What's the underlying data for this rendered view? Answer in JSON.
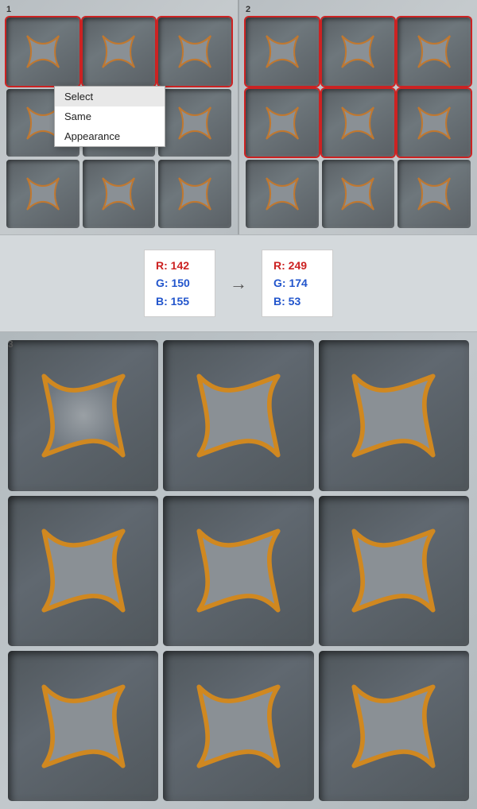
{
  "panels": [
    {
      "id": 1,
      "label": "1"
    },
    {
      "id": 2,
      "label": "2"
    },
    {
      "id": 3,
      "label": "3"
    }
  ],
  "contextMenu": {
    "items": [
      {
        "label": "Select",
        "selected": true
      },
      {
        "label": "Same",
        "hovered": false
      },
      {
        "label": "Appearance",
        "hovered": false
      }
    ]
  },
  "colorFrom": {
    "r_label": "R: 142",
    "g_label": "G: 150",
    "b_label": "B: 155"
  },
  "colorTo": {
    "r_label": "R: 249",
    "g_label": "G: 174",
    "b_label": "B: 53"
  },
  "arrow": "→"
}
